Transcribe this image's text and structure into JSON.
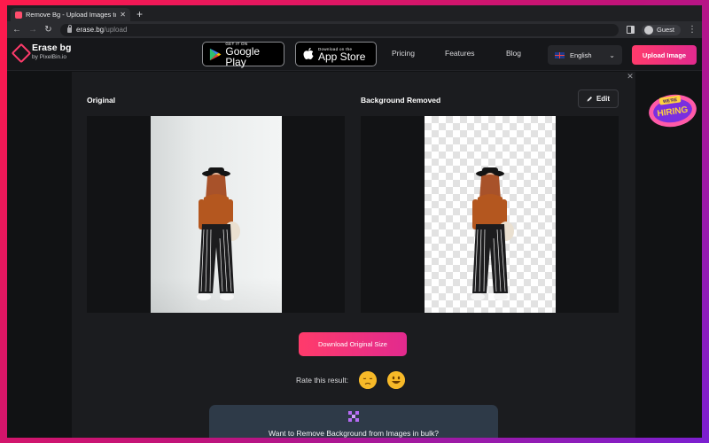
{
  "browser": {
    "tab_title": "Remove Bg - Upload Images to",
    "tab_close": "✕",
    "new_tab": "+",
    "url_host": "erase.bg",
    "url_path": "/upload",
    "profile_label": "Guest"
  },
  "header": {
    "logo_name": "Erase bg",
    "logo_sub": "by PixelBin.io",
    "google_play_small": "GET IT ON",
    "google_play_big": "Google Play",
    "app_store_small": "Download on the",
    "app_store_big": "App Store",
    "nav": [
      "Pricing",
      "Features",
      "Blog"
    ],
    "language": "English",
    "upload_button": "Upload Image"
  },
  "main": {
    "original_title": "Original",
    "removed_title": "Background Removed",
    "edit_button": "Edit",
    "download_button": "Download Original Size",
    "rate_label": "Rate this result:",
    "bulk_text": "Want to Remove Background from Images in bulk?",
    "hiring_small": "WE'RE",
    "hiring_big": "HIRING"
  },
  "colors": {
    "accent_start": "#ff3b6b",
    "accent_end": "#e22a8e",
    "page_bg": "#111214",
    "panel_bg": "#1b1c1f"
  },
  "icons": {
    "back": "arrow-left-icon",
    "forward": "arrow-right-icon",
    "reload": "reload-icon",
    "lock": "lock-icon",
    "edit": "pencil-icon",
    "sad_emoji": "sad-face-icon",
    "happy_emoji": "happy-face-icon",
    "bulk": "grid-pattern-icon"
  }
}
